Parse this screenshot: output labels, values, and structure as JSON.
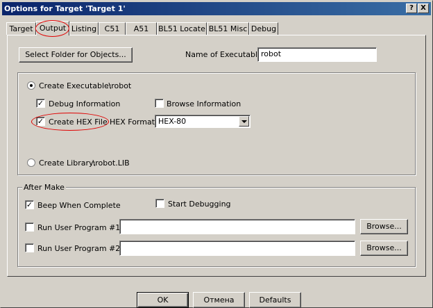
{
  "window": {
    "title": "Options for Target 'Target 1'",
    "help_button": "?",
    "close_button": "X"
  },
  "tabs": [
    {
      "label": "Target"
    },
    {
      "label": "Output",
      "active": true
    },
    {
      "label": "Listing"
    },
    {
      "label": "C51"
    },
    {
      "label": "A51"
    },
    {
      "label": "BL51 Locate"
    },
    {
      "label": "BL51 Misc"
    },
    {
      "label": "Debug"
    }
  ],
  "output": {
    "select_folder_button": "Select Folder for Objects...",
    "name_of_executable_label": "Name of Executable:",
    "name_of_executable_value": "robot",
    "create_executable": {
      "label": "Create Executable:",
      "path": ".\\robot",
      "selected": true
    },
    "debug_information": {
      "label": "Debug Information",
      "checked": true
    },
    "browse_information": {
      "label": "Browse Information",
      "checked": false
    },
    "create_hex_file": {
      "label": "Create HEX File",
      "checked": true
    },
    "hex_format": {
      "label": "HEX Format:",
      "value": "HEX-80"
    },
    "create_library": {
      "label": "Create Library:",
      "path": ".\\robot.LIB",
      "selected": false
    }
  },
  "after_make": {
    "legend": "After Make",
    "beep_when_complete": {
      "label": "Beep When Complete",
      "checked": true
    },
    "start_debugging": {
      "label": "Start Debugging",
      "checked": false
    },
    "run_user_program_1": {
      "label": "Run User Program #1:",
      "checked": false,
      "value": "",
      "browse_label": "Browse..."
    },
    "run_user_program_2": {
      "label": "Run User Program #2:",
      "checked": false,
      "value": "",
      "browse_label": "Browse..."
    }
  },
  "footer": {
    "ok": "OK",
    "cancel": "Отмена",
    "defaults": "Defaults"
  },
  "colors": {
    "face": "#d4d0c8",
    "titlebar_start": "#0a246a",
    "titlebar_end": "#3a6ea5",
    "annotation": "#e00000"
  }
}
